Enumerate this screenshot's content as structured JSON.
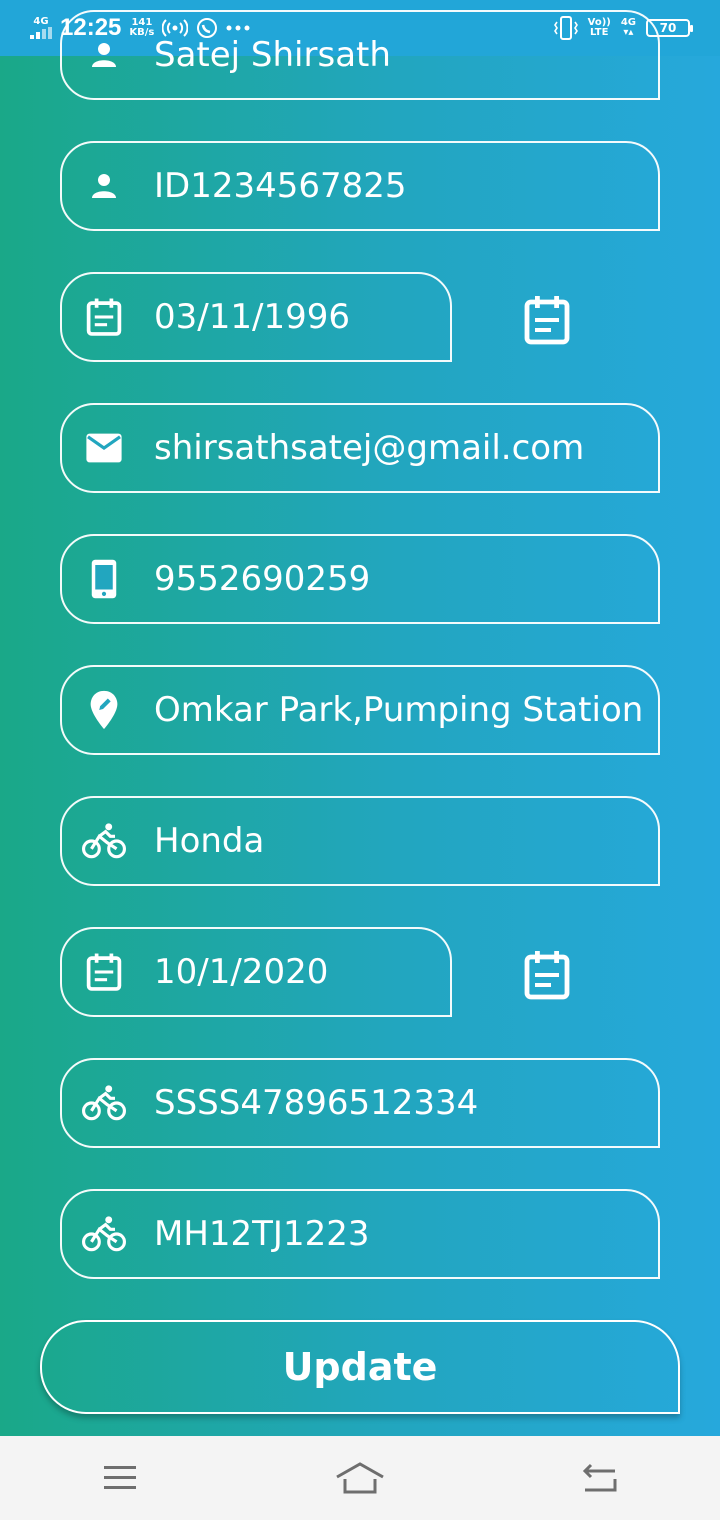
{
  "status_bar": {
    "network": "4G",
    "time": "12:25",
    "speed_value": "141",
    "speed_unit": "KB/s",
    "volte": "Vo))",
    "lte": "LTE",
    "network_right": "4G",
    "battery": "70"
  },
  "form": {
    "name": "Satej Shirsath",
    "id": "ID1234567825",
    "dob": "03/11/1996",
    "email": "shirsathsatej@gmail.com",
    "phone": "9552690259",
    "address": "Omkar Park,Pumping Station",
    "vehicle": "Honda",
    "vehicle_date": "10/1/2020",
    "chassis": "SSSS47896512334",
    "registration": "MH12TJ1223"
  },
  "actions": {
    "update_label": "Update"
  },
  "icons": {
    "name": "person-icon",
    "id": "person-icon",
    "dob": "calendar-icon",
    "email": "mail-icon",
    "phone": "phone-icon",
    "address": "location-pin-icon",
    "vehicle": "bicycle-icon",
    "vehicle_date": "calendar-icon",
    "chassis": "bicycle-icon",
    "registration": "bicycle-icon"
  },
  "colors": {
    "gradient_left": "#1aa888",
    "gradient_right": "#26a8dc",
    "status_bar": "#22a6d8",
    "nav_bar": "#f4f4f4"
  }
}
